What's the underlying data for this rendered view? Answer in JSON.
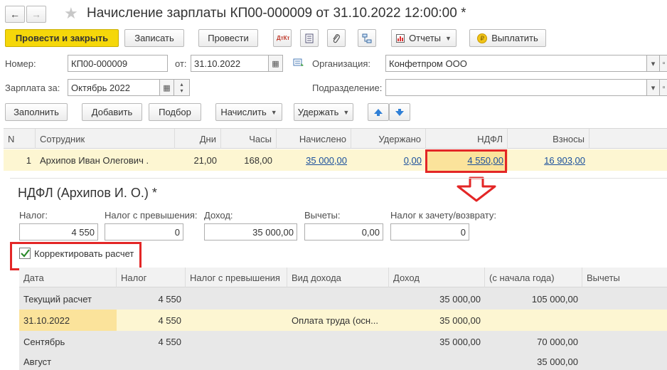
{
  "window": {
    "title": "Начисление зарплаты КП00-000009 от 31.10.2022 12:00:00 *",
    "nav_back": "←",
    "nav_forward": "→",
    "star": "★"
  },
  "toolbar": {
    "post_close": "Провести и закрыть",
    "save": "Записать",
    "post": "Провести",
    "dtkt_icon_text": "ДтКт",
    "reports": "Отчеты",
    "pay": "Выплатить"
  },
  "header": {
    "number_label": "Номер:",
    "number_value": "КП00-000009",
    "from_label": "от:",
    "date_value": "31.10.2022",
    "org_label": "Организация:",
    "org_value": "Конфетпром ООО",
    "salary_for_label": "Зарплата за:",
    "salary_for_value": "Октябрь 2022",
    "dept_label": "Подразделение:",
    "dept_value": ""
  },
  "actions": {
    "fill": "Заполнить",
    "add": "Добавить",
    "select": "Подбор",
    "accrue": "Начислить",
    "withhold": "Удержать"
  },
  "main_table": {
    "columns": [
      "N",
      "Сотрудник",
      "Дни",
      "Часы",
      "Начислено",
      "Удержано",
      "НДФЛ",
      "Взносы"
    ],
    "rows": [
      {
        "n": "1",
        "employee": "Архипов Иван Олегович .",
        "days": "21,00",
        "hours": "168,00",
        "accrued": "35 000,00",
        "withheld": "0,00",
        "ndfl": "4 550,00",
        "contributions": "16 903,00"
      }
    ]
  },
  "ndfl_form": {
    "title": "НДФЛ (Архипов И. О.) *",
    "tax_label": "Налог:",
    "tax_value": "4 550",
    "excess_label": "Налог с превышения:",
    "excess_value": "0",
    "income_label": "Доход:",
    "income_value": "35 000,00",
    "deductions_label": "Вычеты:",
    "deductions_value": "0,00",
    "offset_label": "Налог к зачету/возврату:",
    "offset_value": "0",
    "correct_label": "Корректировать расчет",
    "correct_checked": true
  },
  "detail_table": {
    "columns": [
      "Дата",
      "Налог",
      "Налог с превышения",
      "Вид дохода",
      "Доход",
      "(с начала года)",
      "Вычеты"
    ],
    "rows": [
      {
        "date": "Текущий расчет",
        "tax": "4 550",
        "excess": "",
        "income_type": "",
        "income": "35 000,00",
        "ytd": "105 000,00",
        "deductions": ""
      },
      {
        "date": "31.10.2022",
        "tax": "4 550",
        "excess": "",
        "income_type": "Оплата труда (осн...",
        "income": "35 000,00",
        "ytd": "",
        "deductions": ""
      },
      {
        "date": "Сентябрь",
        "tax": "4 550",
        "excess": "",
        "income_type": "",
        "income": "35 000,00",
        "ytd": "70 000,00",
        "deductions": ""
      },
      {
        "date": "Август",
        "tax": "",
        "excess": "",
        "income_type": "",
        "income": "",
        "ytd": "35 000,00",
        "deductions": ""
      }
    ]
  },
  "colors": {
    "primary_button": "#f5d70a",
    "selected_row": "#fdf6d2",
    "highlight_cell": "#fbe39b",
    "annotation_red": "#e32626",
    "link": "#1a4f9c",
    "grey_area": "#e8e8e8"
  }
}
